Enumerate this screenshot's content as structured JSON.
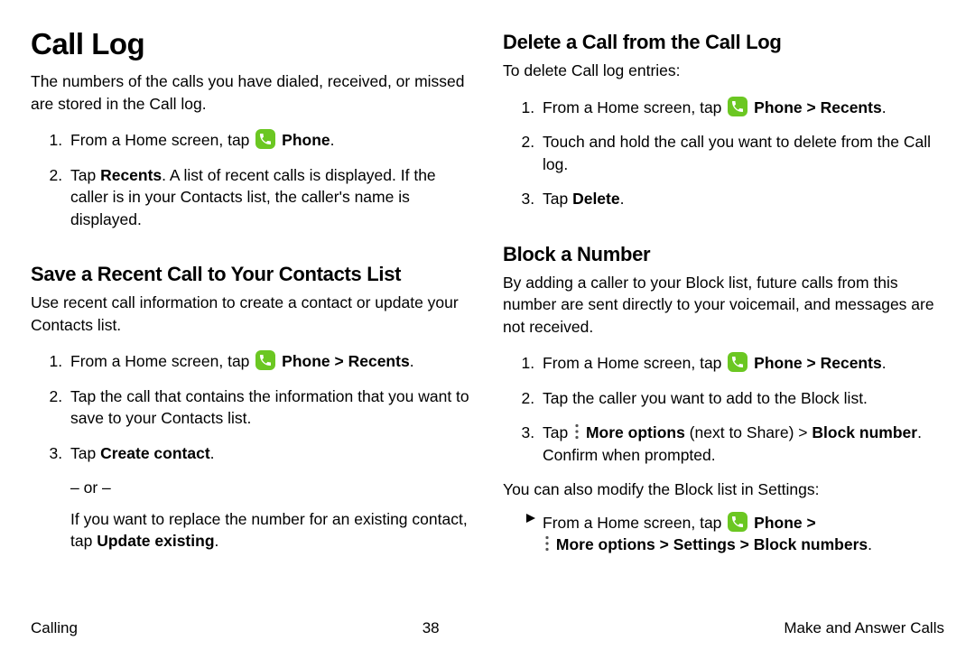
{
  "left": {
    "h1": "Call Log",
    "intro": "The numbers of the calls you have dialed, received, or missed are stored in the Call log.",
    "step1_a": "From a Home screen, tap ",
    "step1_b": "Phone",
    "step2_a": "Tap ",
    "step2_b": "Recents",
    "step2_c": ". A list of recent calls is displayed. If the caller is in your Contacts list, the caller's name is displayed.",
    "h2": "Save a Recent Call to Your Contacts List",
    "save_intro": "Use recent call information to create a contact or update your Contacts list.",
    "sstep1_a": "From a Home screen, tap ",
    "sstep1_b": "Phone",
    "sstep1_c": " > ",
    "sstep1_d": "Recents",
    "sstep2": "Tap the call that contains the information that you want to save to your Contacts list.",
    "sstep3_a": "Tap ",
    "sstep3_b": "Create contact",
    "or": "– or –",
    "sstep3_sub_a": "If you want to replace the number for an existing contact, tap ",
    "sstep3_sub_b": "Update existing",
    "sstep3_sub_c": "."
  },
  "right": {
    "h2a": "Delete a Call from the Call Log",
    "del_intro": "To delete Call log entries:",
    "d1_a": "From a Home screen, tap ",
    "d1_b": "Phone",
    "d1_c": " > ",
    "d1_d": "Recents",
    "d2": "Touch and hold the call you want to delete from the Call log.",
    "d3_a": "Tap ",
    "d3_b": "Delete",
    "h2b": "Block a Number",
    "block_intro": "By adding a caller to your Block list, future calls from this number are sent directly to your voicemail, and messages are not received.",
    "b1_a": "From a Home screen, tap ",
    "b1_b": "Phone",
    "b1_c": " > ",
    "b1_d": "Recents",
    "b2": "Tap the caller you want to add to the Block list.",
    "b3_a": "Tap ",
    "b3_b": "More options",
    "b3_c": " (next to Share) > ",
    "b3_d": "Block number",
    "b3_e": ". Confirm when prompted.",
    "block_also": "You can also modify the Block list in Settings:",
    "bp_a": "From a Home screen, tap ",
    "bp_b": "Phone",
    "bp_c": " > ",
    "bp_d": "More options",
    "bp_e": " > ",
    "bp_f": "Settings",
    "bp_g": " > ",
    "bp_h": "Block numbers",
    "bp_i": "."
  },
  "footer": {
    "left": "Calling",
    "center": "38",
    "right": "Make and Answer Calls"
  }
}
